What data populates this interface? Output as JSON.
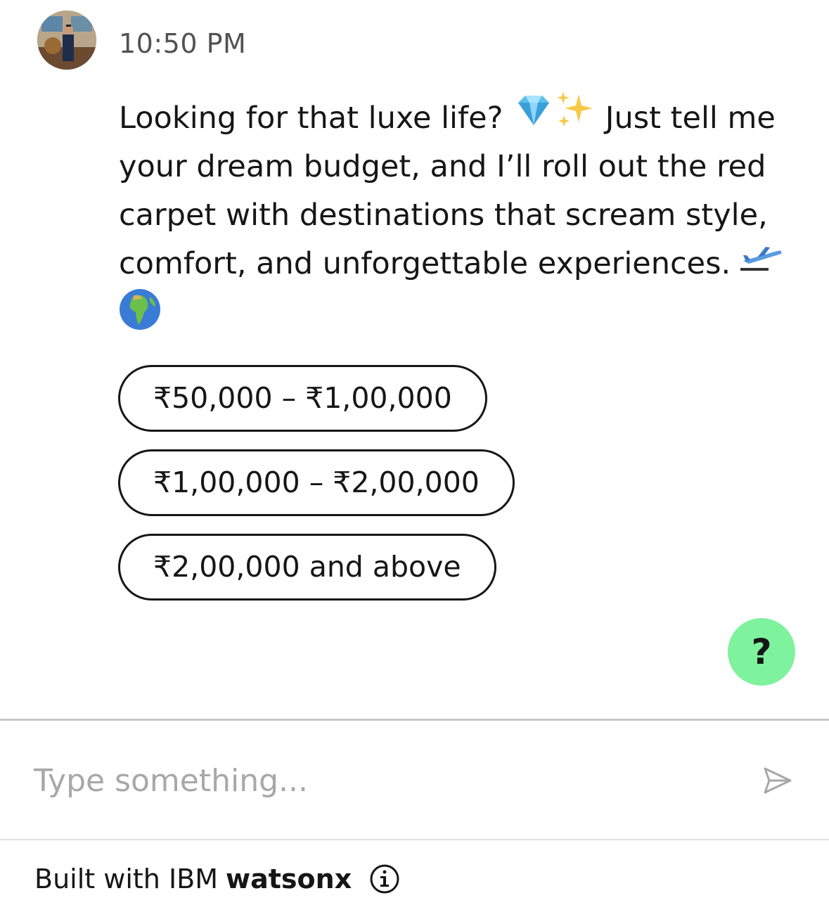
{
  "header": {
    "timestamp": "10:50 PM"
  },
  "message": {
    "text_part1": "Looking for that luxe life? ",
    "emoji_gem": "gem-icon",
    "emoji_sparkles": "sparkles-icon",
    "text_part2": " Just tell me your dream budget, and I’ll roll out the red carpet with destinations that scream style, comfort, and unforgettable experiences. ",
    "emoji_plane": "airplane-departure-icon",
    "emoji_globe": "globe-africa-icon"
  },
  "options": [
    {
      "label": "₹50,000 – ₹1,00,000"
    },
    {
      "label": "₹1,00,000 – ₹2,00,000"
    },
    {
      "label": "₹2,00,000 and above"
    }
  ],
  "help_button": {
    "label": "?",
    "color": "#7ef29d"
  },
  "input": {
    "placeholder": "Type something...",
    "value": ""
  },
  "footer": {
    "prefix": "Built with IBM",
    "brand": "watsonx"
  }
}
